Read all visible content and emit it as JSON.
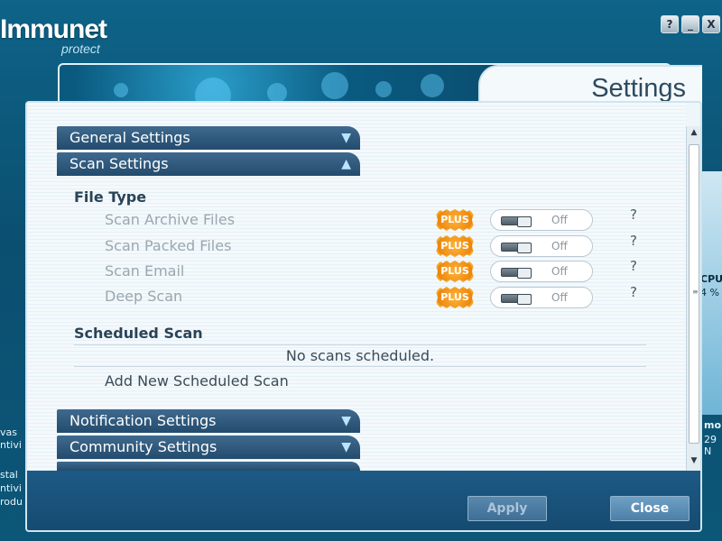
{
  "app": {
    "logo_main": "Immunet",
    "logo_sub": "protect",
    "window_buttons": [
      "?",
      "_",
      "X"
    ],
    "title": "Settings"
  },
  "background_text": {
    "left_lines": [
      "vas",
      "ntivi",
      "stal",
      "ntivi",
      "rodu"
    ],
    "right_top_1": "CPU",
    "right_top_2": "4 %",
    "right_bottom_1": "mo",
    "right_bottom_2": "29 N"
  },
  "sections": {
    "general": {
      "label": "General Settings",
      "arrow": "▼"
    },
    "scan": {
      "label": "Scan Settings",
      "arrow": "▲"
    },
    "notification": {
      "label": "Notification Settings",
      "arrow": "▼"
    },
    "community": {
      "label": "Community Settings",
      "arrow": "▼"
    }
  },
  "file_type": {
    "heading": "File Type",
    "options": [
      {
        "label": "Scan Archive Files",
        "badge": "PLUS",
        "state": "Off",
        "help": "?"
      },
      {
        "label": "Scan Packed Files",
        "badge": "PLUS",
        "state": "Off",
        "help": "?"
      },
      {
        "label": "Scan Email",
        "badge": "PLUS",
        "state": "Off",
        "help": "?"
      },
      {
        "label": "Deep Scan",
        "badge": "PLUS",
        "state": "Off",
        "help": "?"
      }
    ]
  },
  "scheduled_scan": {
    "heading": "Scheduled Scan",
    "empty_message": "No scans scheduled.",
    "add_link": "Add New Scheduled Scan"
  },
  "footer": {
    "apply_label": "Apply",
    "close_label": "Close"
  }
}
